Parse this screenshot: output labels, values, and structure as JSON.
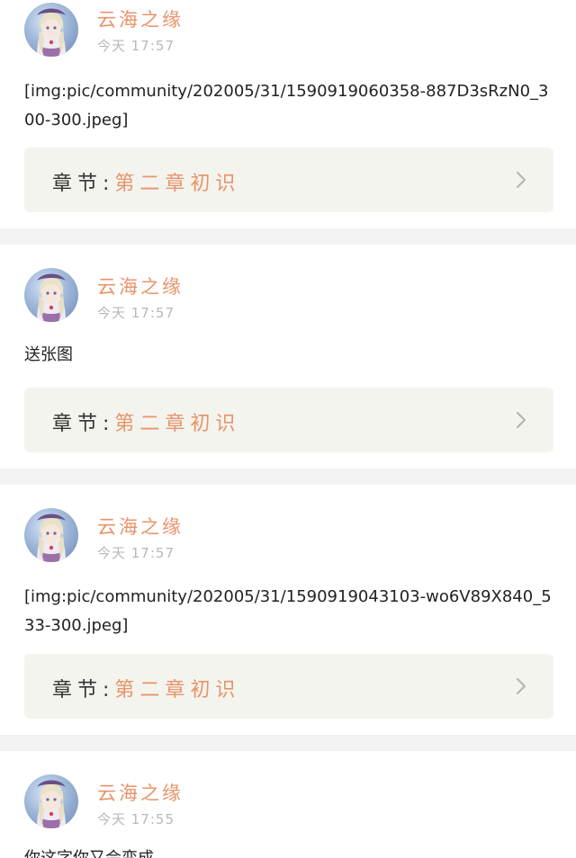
{
  "posts": [
    {
      "username": "云海之缘",
      "time": "今天 17:57",
      "text": "[img:pic/community/202005/31/1590919060358-887D3sRzN0_300-300.jpeg]",
      "chapter_prefix": "章节:",
      "chapter_name": "第二章初识"
    },
    {
      "username": "云海之缘",
      "time": "今天 17:57",
      "text": "送张图",
      "chapter_prefix": "章节:",
      "chapter_name": "第二章初识"
    },
    {
      "username": "云海之缘",
      "time": "今天 17:57",
      "text": "[img:pic/community/202005/31/1590919043103-wo6V89X840_533-300.jpeg]",
      "chapter_prefix": "章节:",
      "chapter_name": "第二章初识"
    },
    {
      "username": "云海之缘",
      "time": "今天 17:55",
      "text": "你这字你又会变成",
      "chapter_prefix": "",
      "chapter_name": ""
    }
  ],
  "colors": {
    "accent": "#e8936a",
    "chapter_bg": "#f4f4ef",
    "divider": "#f3f3f3"
  },
  "icons": {
    "avatar": "anime-girl-avatar",
    "chevron": "chevron-right-icon"
  }
}
